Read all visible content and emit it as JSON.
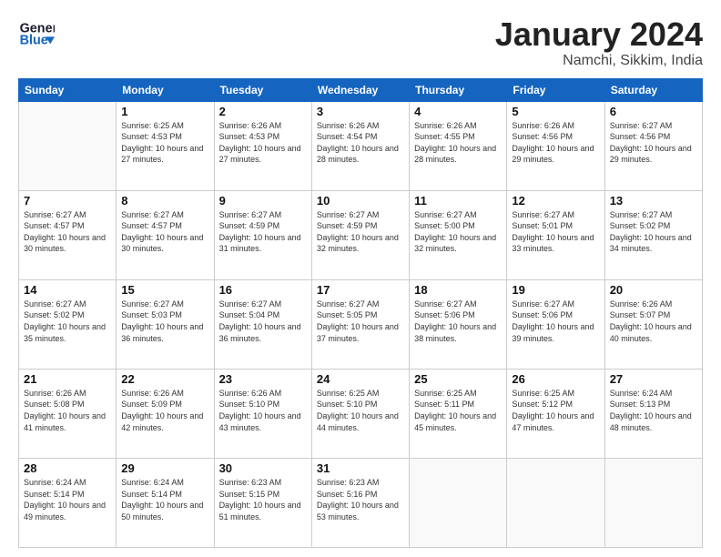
{
  "logo": {
    "line1": "General",
    "line2": "Blue"
  },
  "title": "January 2024",
  "subtitle": "Namchi, Sikkim, India",
  "weekdays": [
    "Sunday",
    "Monday",
    "Tuesday",
    "Wednesday",
    "Thursday",
    "Friday",
    "Saturday"
  ],
  "weeks": [
    [
      {
        "day": "",
        "sunrise": "",
        "sunset": "",
        "daylight": ""
      },
      {
        "day": "1",
        "sunrise": "Sunrise: 6:25 AM",
        "sunset": "Sunset: 4:53 PM",
        "daylight": "Daylight: 10 hours and 27 minutes."
      },
      {
        "day": "2",
        "sunrise": "Sunrise: 6:26 AM",
        "sunset": "Sunset: 4:53 PM",
        "daylight": "Daylight: 10 hours and 27 minutes."
      },
      {
        "day": "3",
        "sunrise": "Sunrise: 6:26 AM",
        "sunset": "Sunset: 4:54 PM",
        "daylight": "Daylight: 10 hours and 28 minutes."
      },
      {
        "day": "4",
        "sunrise": "Sunrise: 6:26 AM",
        "sunset": "Sunset: 4:55 PM",
        "daylight": "Daylight: 10 hours and 28 minutes."
      },
      {
        "day": "5",
        "sunrise": "Sunrise: 6:26 AM",
        "sunset": "Sunset: 4:56 PM",
        "daylight": "Daylight: 10 hours and 29 minutes."
      },
      {
        "day": "6",
        "sunrise": "Sunrise: 6:27 AM",
        "sunset": "Sunset: 4:56 PM",
        "daylight": "Daylight: 10 hours and 29 minutes."
      }
    ],
    [
      {
        "day": "7",
        "sunrise": "Sunrise: 6:27 AM",
        "sunset": "Sunset: 4:57 PM",
        "daylight": "Daylight: 10 hours and 30 minutes."
      },
      {
        "day": "8",
        "sunrise": "Sunrise: 6:27 AM",
        "sunset": "Sunset: 4:57 PM",
        "daylight": "Daylight: 10 hours and 30 minutes."
      },
      {
        "day": "9",
        "sunrise": "Sunrise: 6:27 AM",
        "sunset": "Sunset: 4:59 PM",
        "daylight": "Daylight: 10 hours and 31 minutes."
      },
      {
        "day": "10",
        "sunrise": "Sunrise: 6:27 AM",
        "sunset": "Sunset: 4:59 PM",
        "daylight": "Daylight: 10 hours and 32 minutes."
      },
      {
        "day": "11",
        "sunrise": "Sunrise: 6:27 AM",
        "sunset": "Sunset: 5:00 PM",
        "daylight": "Daylight: 10 hours and 32 minutes."
      },
      {
        "day": "12",
        "sunrise": "Sunrise: 6:27 AM",
        "sunset": "Sunset: 5:01 PM",
        "daylight": "Daylight: 10 hours and 33 minutes."
      },
      {
        "day": "13",
        "sunrise": "Sunrise: 6:27 AM",
        "sunset": "Sunset: 5:02 PM",
        "daylight": "Daylight: 10 hours and 34 minutes."
      }
    ],
    [
      {
        "day": "14",
        "sunrise": "Sunrise: 6:27 AM",
        "sunset": "Sunset: 5:02 PM",
        "daylight": "Daylight: 10 hours and 35 minutes."
      },
      {
        "day": "15",
        "sunrise": "Sunrise: 6:27 AM",
        "sunset": "Sunset: 5:03 PM",
        "daylight": "Daylight: 10 hours and 36 minutes."
      },
      {
        "day": "16",
        "sunrise": "Sunrise: 6:27 AM",
        "sunset": "Sunset: 5:04 PM",
        "daylight": "Daylight: 10 hours and 36 minutes."
      },
      {
        "day": "17",
        "sunrise": "Sunrise: 6:27 AM",
        "sunset": "Sunset: 5:05 PM",
        "daylight": "Daylight: 10 hours and 37 minutes."
      },
      {
        "day": "18",
        "sunrise": "Sunrise: 6:27 AM",
        "sunset": "Sunset: 5:06 PM",
        "daylight": "Daylight: 10 hours and 38 minutes."
      },
      {
        "day": "19",
        "sunrise": "Sunrise: 6:27 AM",
        "sunset": "Sunset: 5:06 PM",
        "daylight": "Daylight: 10 hours and 39 minutes."
      },
      {
        "day": "20",
        "sunrise": "Sunrise: 6:26 AM",
        "sunset": "Sunset: 5:07 PM",
        "daylight": "Daylight: 10 hours and 40 minutes."
      }
    ],
    [
      {
        "day": "21",
        "sunrise": "Sunrise: 6:26 AM",
        "sunset": "Sunset: 5:08 PM",
        "daylight": "Daylight: 10 hours and 41 minutes."
      },
      {
        "day": "22",
        "sunrise": "Sunrise: 6:26 AM",
        "sunset": "Sunset: 5:09 PM",
        "daylight": "Daylight: 10 hours and 42 minutes."
      },
      {
        "day": "23",
        "sunrise": "Sunrise: 6:26 AM",
        "sunset": "Sunset: 5:10 PM",
        "daylight": "Daylight: 10 hours and 43 minutes."
      },
      {
        "day": "24",
        "sunrise": "Sunrise: 6:25 AM",
        "sunset": "Sunset: 5:10 PM",
        "daylight": "Daylight: 10 hours and 44 minutes."
      },
      {
        "day": "25",
        "sunrise": "Sunrise: 6:25 AM",
        "sunset": "Sunset: 5:11 PM",
        "daylight": "Daylight: 10 hours and 45 minutes."
      },
      {
        "day": "26",
        "sunrise": "Sunrise: 6:25 AM",
        "sunset": "Sunset: 5:12 PM",
        "daylight": "Daylight: 10 hours and 47 minutes."
      },
      {
        "day": "27",
        "sunrise": "Sunrise: 6:24 AM",
        "sunset": "Sunset: 5:13 PM",
        "daylight": "Daylight: 10 hours and 48 minutes."
      }
    ],
    [
      {
        "day": "28",
        "sunrise": "Sunrise: 6:24 AM",
        "sunset": "Sunset: 5:14 PM",
        "daylight": "Daylight: 10 hours and 49 minutes."
      },
      {
        "day": "29",
        "sunrise": "Sunrise: 6:24 AM",
        "sunset": "Sunset: 5:14 PM",
        "daylight": "Daylight: 10 hours and 50 minutes."
      },
      {
        "day": "30",
        "sunrise": "Sunrise: 6:23 AM",
        "sunset": "Sunset: 5:15 PM",
        "daylight": "Daylight: 10 hours and 51 minutes."
      },
      {
        "day": "31",
        "sunrise": "Sunrise: 6:23 AM",
        "sunset": "Sunset: 5:16 PM",
        "daylight": "Daylight: 10 hours and 53 minutes."
      },
      {
        "day": "",
        "sunrise": "",
        "sunset": "",
        "daylight": ""
      },
      {
        "day": "",
        "sunrise": "",
        "sunset": "",
        "daylight": ""
      },
      {
        "day": "",
        "sunrise": "",
        "sunset": "",
        "daylight": ""
      }
    ]
  ]
}
